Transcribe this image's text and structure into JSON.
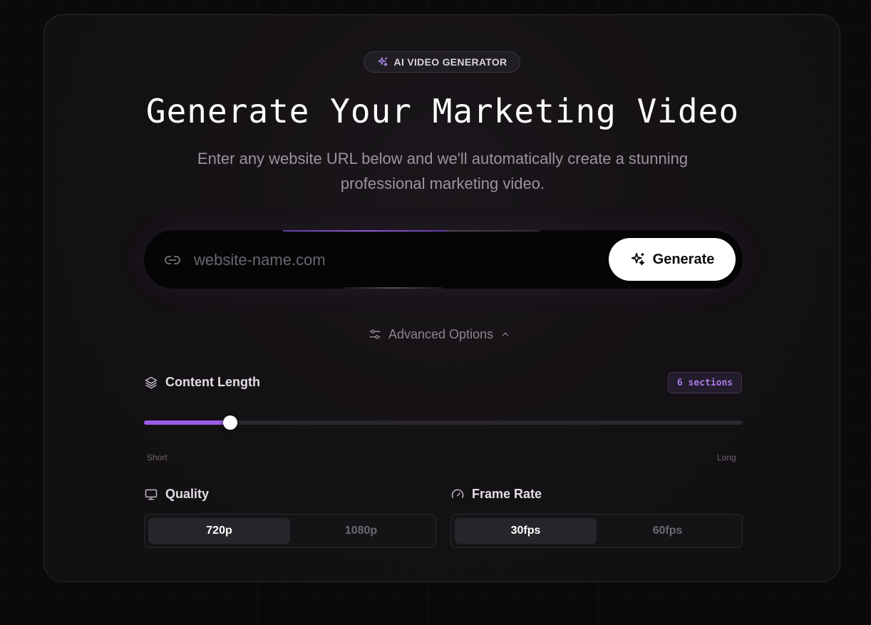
{
  "badge": {
    "label": "AI VIDEO GENERATOR",
    "icon": "sparkles-icon",
    "icon_color": "#b28cf0"
  },
  "hero": {
    "title": "Generate Your Marketing Video",
    "subtitle": "Enter any website URL below and we'll automatically create a stunning professional marketing video."
  },
  "url_input": {
    "placeholder": "website-name.com",
    "value": "",
    "icon": "link-icon"
  },
  "generate_button": {
    "label": "Generate",
    "icon": "sparkles-icon"
  },
  "advanced_options": {
    "label": "Advanced Options",
    "expanded": true,
    "icon": "sliders-icon"
  },
  "content_length": {
    "label": "Content Length",
    "icon": "layers-icon",
    "badge": "6 sections",
    "slider_fraction": 0.144,
    "min_label": "Short",
    "max_label": "Long",
    "accent_color": "#9d5ce8"
  },
  "quality": {
    "label": "Quality",
    "icon": "monitor-icon",
    "options": [
      "720p",
      "1080p"
    ],
    "selected": "720p"
  },
  "frame_rate": {
    "label": "Frame Rate",
    "icon": "gauge-icon",
    "options": [
      "30fps",
      "60fps"
    ],
    "selected": "30fps"
  }
}
